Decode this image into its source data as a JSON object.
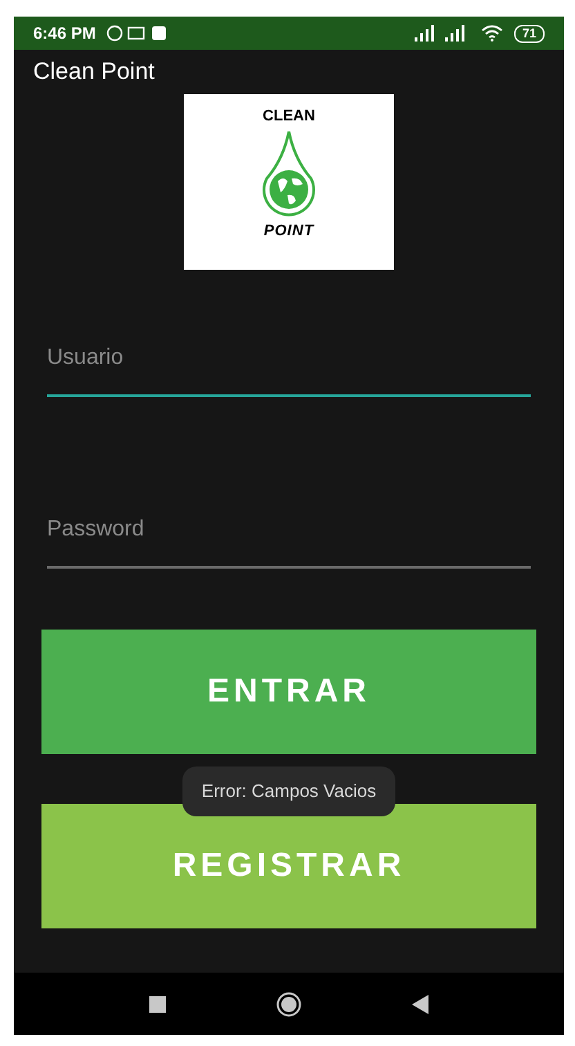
{
  "status_bar": {
    "time": "6:46 PM",
    "battery": "71"
  },
  "app_bar": {
    "title": "Clean Point"
  },
  "logo": {
    "top_text": "CLEAN",
    "bottom_text": "POINT"
  },
  "fields": [
    {
      "placeholder": "Usuario",
      "focused": true
    },
    {
      "placeholder": "Password",
      "focused": false
    }
  ],
  "buttons": [
    {
      "label": "ENTRAR",
      "kind": "primary"
    },
    {
      "label": "REGISTRAR",
      "kind": "secondary"
    }
  ],
  "toast": {
    "text": "Error: Campos Vacios"
  }
}
